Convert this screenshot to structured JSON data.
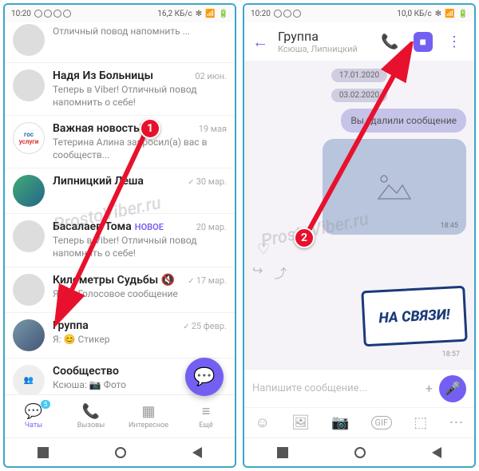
{
  "left": {
    "status": {
      "time": "10:20",
      "net": "16,2 КБ/с"
    },
    "chats": [
      {
        "name": "",
        "preview": "Отличный повод напомнить ...",
        "time": ""
      },
      {
        "name": "Надя Из Больницы",
        "preview": "Теперь в Viber! Отличный повод напомнить о себе!",
        "time": "02 июн."
      },
      {
        "name": "Важная новость!",
        "preview": "Тетерина Алина запросил(а) вас в сообществ...",
        "time": "19 мая"
      },
      {
        "name": "Липницкий Леша",
        "preview": "",
        "time": "30 мар.",
        "check": true
      },
      {
        "name": "Басалаев Тома",
        "preview": "Теперь в Viber! Отличный повод напомнить о себе!",
        "time": "20 мар.",
        "badge": "НОВОЕ"
      },
      {
        "name": "Километры Судьбы",
        "preview": "Я: 📎 Голосовое сообщение",
        "time": "17 мар.",
        "check": true,
        "sound": true
      },
      {
        "name": "Группа",
        "preview": "Я: 😊 Стикер",
        "time": "25 февр.",
        "check": true
      },
      {
        "name": "Сообщество",
        "preview": "Ксюша: 📷 Фото",
        "time": ""
      }
    ],
    "nav": {
      "items": [
        {
          "label": "Чаты",
          "badge": "5"
        },
        {
          "label": "Вызовы"
        },
        {
          "label": "Интересное"
        },
        {
          "label": "Ещё"
        }
      ]
    }
  },
  "right": {
    "status": {
      "time": "10:20",
      "net": "10,0 КБ/с"
    },
    "header": {
      "title": "Группа",
      "subtitle": "Ксюша, Липницкий"
    },
    "dates": [
      "17.01.2020",
      "03.02.2020"
    ],
    "deleted_msg": "Вы удалили сообщение",
    "image_time": "18:45",
    "sticker_text": "НА СВЯЗИ!",
    "sticker_time": "18:57",
    "input_placeholder": "Напишите сообщение..."
  },
  "annotations": {
    "marker1": "1",
    "marker2": "2",
    "watermark": "ProstoViber.ru"
  }
}
